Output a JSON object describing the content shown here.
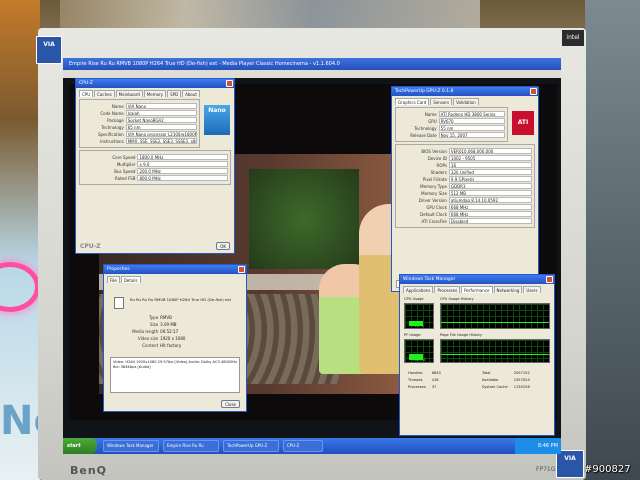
{
  "monitor": {
    "brand": "BenQ",
    "model": "FP71G",
    "sticker_top": "VIA",
    "sticker_bottom": "VIA",
    "intel_label": "intel",
    "watermark": "#900827"
  },
  "surroundings": {
    "side_text": "Net"
  },
  "player": {
    "title": "Empire Rise Ru Ru RMVB 1080P H264 True HD (De-fish) ext - Media Player Classic Homecinema - v1.1.604.0"
  },
  "cpuz": {
    "title": "CPU-Z",
    "tabs": [
      "CPU",
      "Caches",
      "Mainboard",
      "Memory",
      "SPD",
      "About"
    ],
    "processor": [
      {
        "label": "Name",
        "value": "VIA Nano"
      },
      {
        "label": "Code Name",
        "value": "Isaiah"
      },
      {
        "label": "Package",
        "value": "Socket NanoBGA2"
      },
      {
        "label": "Technology",
        "value": "65 nm"
      },
      {
        "label": "Specification",
        "value": "VIA Nano processor L2100@1800MHz"
      },
      {
        "label": "Instructions",
        "value": "MMX, SSE, SSE2, SSE3, SSSE3, x86-64"
      }
    ],
    "clocks": [
      {
        "label": "Core Speed",
        "value": "1800.0 MHz"
      },
      {
        "label": "Multiplier",
        "value": "x 9.0"
      },
      {
        "label": "Bus Speed",
        "value": "200.0 MHz"
      },
      {
        "label": "Rated FSB",
        "value": "800.0 MHz"
      }
    ],
    "logo": "Nano",
    "footer": "CPU-Z",
    "ok_label": "OK"
  },
  "gpuz": {
    "title": "TechPowerUp GPU-Z 0.1.8",
    "tabs": [
      "Graphics Card",
      "Sensors",
      "Validation"
    ],
    "rows": [
      {
        "label": "Name",
        "value": "ATI Radeon HD 3800 Series"
      },
      {
        "label": "GPU",
        "value": "RV670"
      },
      {
        "label": "Technology",
        "value": "55 nm"
      },
      {
        "label": "Release Date",
        "value": "Nov 15, 2007"
      },
      {
        "label": "BIOS Version",
        "value": "VER010.068.000.000"
      },
      {
        "label": "Device ID",
        "value": "1002 - 9505"
      },
      {
        "label": "ROPs",
        "value": "16"
      },
      {
        "label": "Shaders",
        "value": "320 Unified"
      },
      {
        "label": "Pixel Fillrate",
        "value": "9.9 GPixel/s"
      },
      {
        "label": "Memory Type",
        "value": "GDDR3"
      },
      {
        "label": "Memory Size",
        "value": "512 MB"
      },
      {
        "label": "Driver Version",
        "value": "atiumdag 8.14.10.0592"
      },
      {
        "label": "GPU Clock",
        "value": "668 MHz"
      },
      {
        "label": "Default Clock",
        "value": "668 MHz"
      },
      {
        "label": "ATI CrossFire",
        "value": "Disabled"
      }
    ],
    "logo": "ATI",
    "selector": "ATI Radeon HD 3800 Series"
  },
  "properties": {
    "title": "Properties",
    "tabs": [
      "File",
      "Details"
    ],
    "file_name": "Ru Ru Ru Ru RMVB 1080P H264 True HD (De-fish) ext",
    "rows": [
      {
        "label": "Type",
        "value": "RMVB"
      },
      {
        "label": "Size",
        "value": "3.09 MB"
      },
      {
        "label": "Media length",
        "value": "00:52:17"
      },
      {
        "label": "Video size",
        "value": "1920 x 1080"
      },
      {
        "label": "Content",
        "value": "Hit factory"
      }
    ],
    "note": "Video: H264 1920x1080 29.97fps [Video] Audio: Dolby AC3 48000Hz 6ch 384Kbps [Audio]",
    "button": "Close"
  },
  "taskmgr": {
    "title": "Windows Task Manager",
    "tabs": [
      "Applications",
      "Processes",
      "Performance",
      "Networking",
      "Users"
    ],
    "cpu_usage_label": "CPU Usage",
    "cpu_history_label": "CPU Usage History",
    "pf_usage_label": "PF Usage",
    "pf_history_label": "Page File Usage History",
    "cpu_value": "25 %",
    "cpu_fraction": 0.25,
    "pf_value": "360 MB",
    "pf_fraction": 0.35,
    "totals": [
      [
        "Handles",
        "6845"
      ],
      [
        "Threads",
        "418"
      ],
      [
        "Processes",
        "37"
      ]
    ],
    "physical": [
      [
        "Total",
        "2097152"
      ],
      [
        "Available",
        "1357024"
      ],
      [
        "System Cache",
        "1130256"
      ]
    ]
  },
  "taskbar": {
    "start": "start",
    "buttons": [
      "Windows Task Manager",
      "Empire Rise Ru Ru",
      "TechPowerUp GPU-Z",
      "CPU-Z"
    ],
    "clock": "8:46 PM"
  }
}
